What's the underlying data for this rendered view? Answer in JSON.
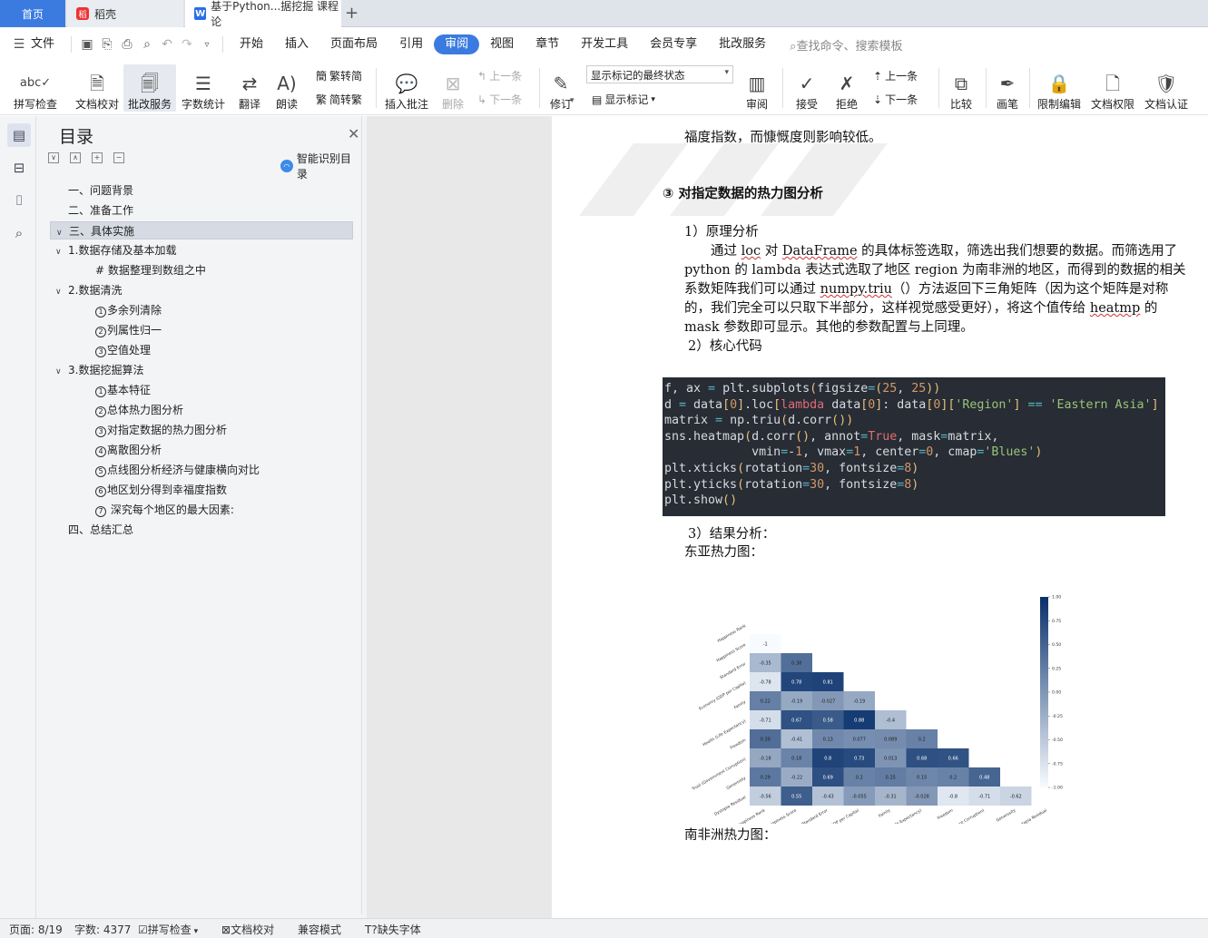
{
  "tabs": {
    "home": "首页",
    "docer": "稻壳",
    "doc": "基于Python...据挖掘 课程论"
  },
  "menu": {
    "file": "文件",
    "items": [
      "开始",
      "插入",
      "页面布局",
      "引用",
      "审阅",
      "视图",
      "章节",
      "开发工具",
      "会员专享",
      "批改服务"
    ],
    "active": "审阅",
    "search": "查找命令、搜索模板"
  },
  "ribbon": {
    "spell": "拼写检查",
    "proof": "文档校对",
    "grade": "批改服务",
    "wordcount": "字数统计",
    "translate": "翻译",
    "read": "朗读",
    "t2s": "繁转简",
    "s2t": "简转繁",
    "insert_comment": "插入批注",
    "delete": "删除",
    "prev": "上一条",
    "next": "下一条",
    "markup_state": "显示标记的最终状态",
    "track": "修订",
    "show_markup": "显示标记",
    "review": "审阅",
    "accept": "接受",
    "reject": "拒绝",
    "prev2": "上一条",
    "next2": "下一条",
    "compare": "比较",
    "ink": "画笔",
    "restrict": "限制编辑",
    "perm": "文档权限",
    "cert": "文档认证"
  },
  "toc": {
    "title": "目录",
    "smart": "智能识别目录",
    "items": [
      {
        "label": "一、问题背景",
        "level": 1
      },
      {
        "label": "二、准备工作",
        "level": 1
      },
      {
        "label": "三、具体实施",
        "level": 1,
        "caret": "∨",
        "selected": true
      },
      {
        "label": "1.数据存储及基本加载",
        "level": 2,
        "caret": "∨"
      },
      {
        "label": "# 数据整理到数组之中",
        "level": 3
      },
      {
        "label": "2.数据清洗",
        "level": 2,
        "caret": "∨"
      },
      {
        "label": "多余列清除",
        "level": 3,
        "num": "1"
      },
      {
        "label": "列属性归一",
        "level": 3,
        "num": "2"
      },
      {
        "label": "空值处理",
        "level": 3,
        "num": "3"
      },
      {
        "label": "3.数据挖掘算法",
        "level": 2,
        "caret": "∨"
      },
      {
        "label": "基本特征",
        "level": 3,
        "num": "1"
      },
      {
        "label": "总体热力图分析",
        "level": 3,
        "num": "2"
      },
      {
        "label": "对指定数据的热力图分析",
        "level": 3,
        "num": "3"
      },
      {
        "label": "离散图分析",
        "level": 3,
        "num": "4"
      },
      {
        "label": "点线图分析经济与健康横向对比",
        "level": 3,
        "num": "5"
      },
      {
        "label": "地区划分得到幸福度指数",
        "level": 3,
        "num": "6"
      },
      {
        "label": " 深究每个地区的最大因素:",
        "level": 3,
        "num": "7"
      },
      {
        "label": "四、总结汇总",
        "level": 1
      }
    ]
  },
  "doc": {
    "line_top": "福度指数，而慷慨度则影响较低。",
    "heading_num": "③",
    "heading": "对指定数据的热力图分析",
    "sub1": "1）原理分析",
    "para": [
      [
        "　　通过 ",
        "loc",
        " 对 ",
        "DataFrame",
        " 的具体标签选取，筛选出我们想要的数据。而筛选用了"
      ],
      [
        "python 的 lambda 表达式选取了地区 region 为南非洲的地区，而得到的数据的相关"
      ],
      [
        "系数矩阵我们可以通过 ",
        "numpy.triu",
        "（）方法返回下三角矩阵（因为这个矩阵是对称"
      ],
      [
        "的，我们完全可以只取下半部分，这样视觉感受更好），将这个值传给 ",
        "heatmp",
        " 的"
      ],
      [
        "mask 参数即可显示。其他的参数配置与上同理。"
      ]
    ],
    "sub2": "2）核心代码",
    "code": [
      "f, ax = plt.subplots(figsize=(25, 25))",
      "d = data[0].loc[lambda data[0]: data[0]['Region'] == 'Eastern Asia']",
      "matrix = np.triu(d.corr())",
      "sns.heatmap(d.corr(), annot=True, mask=matrix,",
      "            vmin=-1, vmax=1, center=0, cmap='Blues')",
      "plt.xticks(rotation=30, fontsize=8)",
      "plt.yticks(rotation=30, fontsize=8)",
      "plt.show()"
    ],
    "sub3": "3）结果分析：",
    "caption1": "东亚热力图：",
    "caption2": "南非洲热力图："
  },
  "heatmap": {
    "labels": [
      "Happiness Rank",
      "Happiness Score",
      "Standard Error",
      "Economy (GDP per Capita)",
      "Family",
      "Health (Life Expectancy)",
      "Freedom",
      "Trust (Government Corruption)",
      "Generosity",
      "Dystopia Residual"
    ],
    "rows": [
      [],
      [
        "-1"
      ],
      [
        "-0.35",
        "0.38"
      ],
      [
        "-0.78",
        "0.78",
        "0.81"
      ],
      [
        "0.22",
        "-0.19",
        "-0.027",
        "-0.19"
      ],
      [
        "-0.71",
        "0.67",
        "0.58",
        "0.88",
        "-0.4"
      ],
      [
        "0.39",
        "-0.41",
        "0.13",
        "0.077",
        "0.089",
        "0.2"
      ],
      [
        "-0.18",
        "0.18",
        "0.8",
        "0.73",
        "0.013",
        "0.68",
        "0.66"
      ],
      [
        "0.29",
        "-0.22",
        "0.69",
        "0.2",
        "0.25",
        "0.15",
        "0.2",
        "0.48"
      ],
      [
        "-0.56",
        "0.55",
        "-0.43",
        "-0.055",
        "-0.31",
        "-0.028",
        "-0.8",
        "-0.71",
        "-0.62"
      ]
    ],
    "colorbar": [
      "1.00",
      "0.75",
      "0.50",
      "0.25",
      "0.00",
      "-0.25",
      "-0.50",
      "-0.75",
      "-1.00"
    ]
  },
  "status": {
    "page": "页面: 8/19",
    "words": "字数: 4377",
    "spell": "拼写检查",
    "proof": "文档校对",
    "compat": "兼容模式",
    "font": "缺失字体"
  }
}
